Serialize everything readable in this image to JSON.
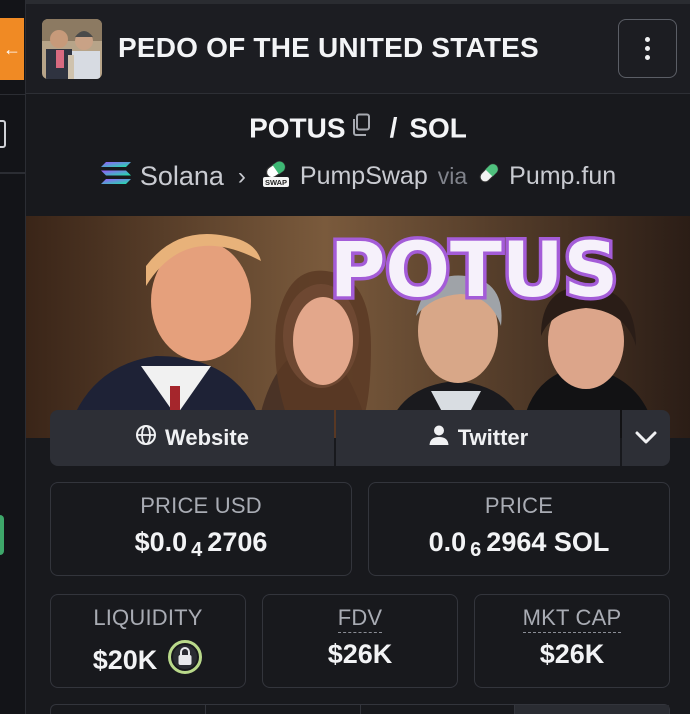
{
  "header": {
    "token_name": "PEDO OF THE UNITED STATES",
    "menu_icon": "more-vertical-icon"
  },
  "pair": {
    "base": "POTUS",
    "separator": "/",
    "quote": "SOL"
  },
  "chain": {
    "name": "Solana",
    "dex": "PumpSwap",
    "dex_badge": "SWAP",
    "via": "via",
    "launchpad": "Pump.fun"
  },
  "banner": {
    "title": "POTUS"
  },
  "links": {
    "website_label": "Website",
    "twitter_label": "Twitter"
  },
  "stats": {
    "price_usd": {
      "label": "PRICE USD",
      "prefix": "$0.0",
      "zeros": "4",
      "digits": "2706"
    },
    "price_native": {
      "label": "PRICE",
      "prefix": "0.0",
      "zeros": "6",
      "digits": "2964 SOL"
    },
    "liquidity": {
      "label": "LIQUIDITY",
      "value": "$20K"
    },
    "fdv": {
      "label": "FDV",
      "value": "$26K"
    },
    "market_cap": {
      "label": "MKT CAP",
      "value": "$26K"
    }
  },
  "colors": {
    "accent_orange": "#f08a24",
    "banner_text_fill": "#f4eefb",
    "banner_text_stroke": "#9b59d0",
    "liquidity_lock": "#b9d98a"
  }
}
